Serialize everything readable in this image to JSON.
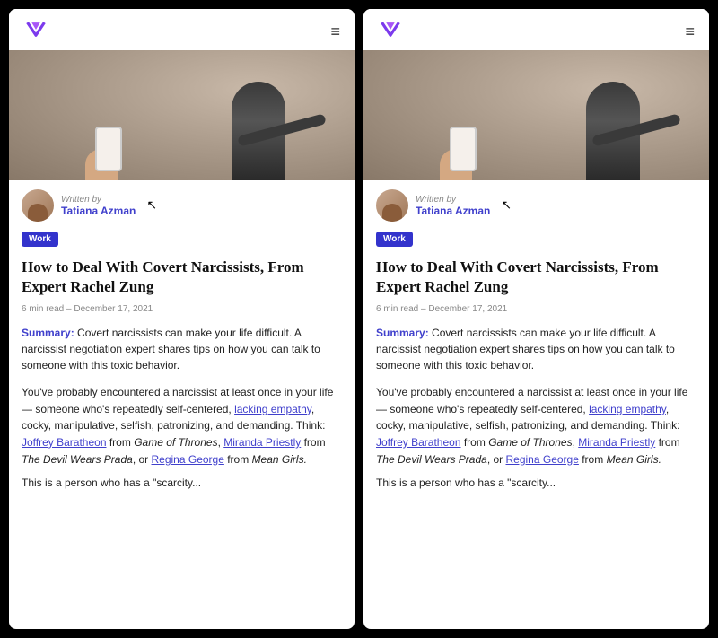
{
  "panels": [
    {
      "id": "left",
      "nav": {
        "logo_alt": "Logo",
        "menu_icon": "≡"
      },
      "author": {
        "written_by_label": "Written by",
        "name": "Tatiana Azman"
      },
      "tag": "Work",
      "title": "How to Deal With Covert Narcissists, From Expert Rachel Zung",
      "meta": "6 min read  –  December 17, 2021",
      "summary_label": "Summary:",
      "summary_text": " Covert narcissists can make your life difficult. A narcissist negotiation expert shares tips on how you can talk to someone with this toxic behavior.",
      "body_paragraphs": [
        "You've probably encountered a narcissist at least once in your life — someone who's repeatedly self-centered, lacking empathy, cocky, manipulative, selfish, patronizing, and demanding. Think: Joffrey Baratheon from Game of Thrones, Miranda Priestly from The Devil Wears Prada, or Regina George from Mean Girls.",
        "This is a person who has a \"scarcity..."
      ],
      "links": {
        "lacking_empathy": "lacking empathy",
        "joffrey": "Joffrey Baratheon",
        "game_of_thrones": "Game of Thrones",
        "miranda": "Miranda Priestly",
        "devil_prada": "The Devil Wears Prada",
        "regina": "Regina George",
        "mean_girls": "Mean Girls"
      }
    },
    {
      "id": "right",
      "nav": {
        "logo_alt": "Logo",
        "menu_icon": "≡"
      },
      "author": {
        "written_by_label": "Written by",
        "name": "Tatiana Azman"
      },
      "tag": "Work",
      "title": "How to Deal With Covert Narcissists, From Expert Rachel Zung",
      "meta": "6 min read  –  December 17, 2021",
      "summary_label": "Summary:",
      "summary_text": " Covert narcissists can make your life difficult. A narcissist negotiation expert shares tips on how you can talk to someone with this toxic behavior.",
      "body_paragraphs": [
        "You've probably encountered a narcissist at least once in your life — someone who's repeatedly self-centered, lacking empathy, cocky, manipulative, selfish, patronizing, and demanding. Think: Joffrey Baratheon from Game of Thrones, Miranda Priestly from The Devil Wears Prada, or Regina George from Mean Girls.",
        "This is a person who has a \"scarcity..."
      ],
      "links": {
        "lacking_empathy": "lacking empathy",
        "joffrey": "Joffrey Baratheon",
        "game_of_thrones": "Game of Thrones",
        "miranda": "Miranda Priestly",
        "devil_prada": "The Devil Wears Prada",
        "regina": "Regina George",
        "mean_girls": "Mean Girls"
      }
    }
  ],
  "brand": {
    "accent_color": "#4040cc",
    "tag_color": "#3333cc",
    "logo_color_top": "#7c3aed",
    "logo_color_bottom": "#a855f7"
  }
}
